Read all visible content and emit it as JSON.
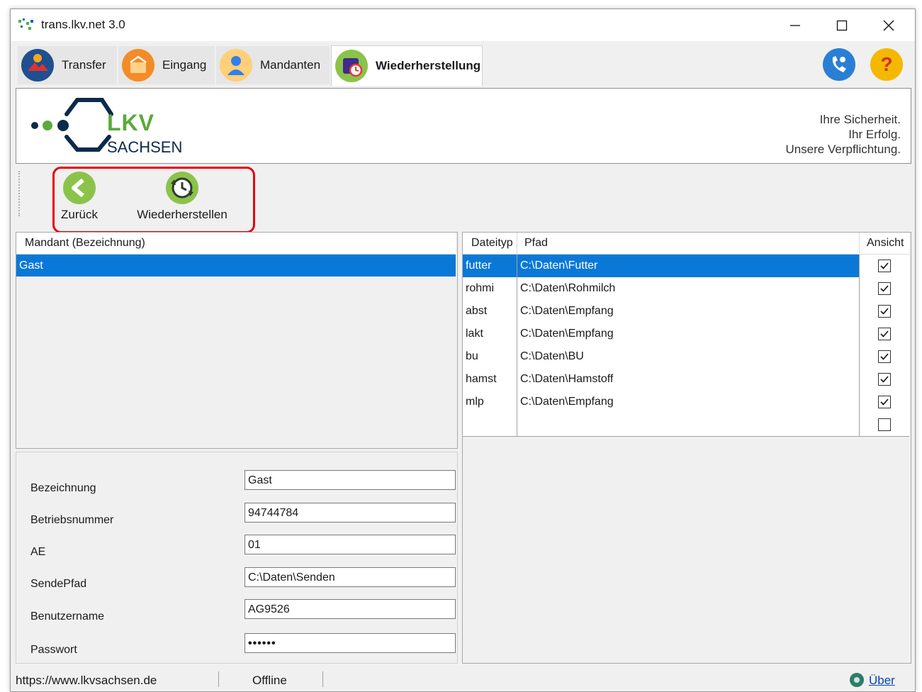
{
  "window": {
    "title": "trans.lkv.net 3.0"
  },
  "tabs": [
    {
      "label": "Transfer",
      "icon": "transfer-icon"
    },
    {
      "label": "Eingang",
      "icon": "inbox-icon"
    },
    {
      "label": "Mandanten",
      "icon": "user-icon"
    },
    {
      "label": "Wiederherstellung",
      "icon": "restore-icon",
      "active": true
    }
  ],
  "header_icons": [
    "phone-support-icon",
    "help-icon"
  ],
  "banner": {
    "logo_top": "LKV",
    "logo_bottom": "SACHSEN",
    "tagline": [
      "Ihre Sicherheit.",
      "Ihr Erfolg.",
      "Unsere Verpflichtung."
    ]
  },
  "toolbar": {
    "back_label": "Zurück",
    "restore_label": "Wiederherstellen"
  },
  "mandant_list": {
    "header": "Mandant (Bezeichnung)",
    "rows": [
      "Gast"
    ]
  },
  "form": {
    "fields": [
      {
        "label": "Bezeichnung",
        "value": "Gast"
      },
      {
        "label": "Betriebsnummer",
        "value": "94744784"
      },
      {
        "label": "AE",
        "value": "01"
      },
      {
        "label": "SendePfad",
        "value": "C:\\Daten\\Senden"
      },
      {
        "label": "Benutzername",
        "value": "AG9526"
      },
      {
        "label": "Passwort",
        "value": "••••••"
      }
    ]
  },
  "file_table": {
    "headers": [
      "Dateityp",
      "Pfad",
      "Ansicht"
    ],
    "rows": [
      {
        "type": "futter",
        "path": "C:\\Daten\\Futter",
        "checked": true
      },
      {
        "type": "rohmi",
        "path": "C:\\Daten\\Rohmilch",
        "checked": true
      },
      {
        "type": "abst",
        "path": "C:\\Daten\\Empfang",
        "checked": true
      },
      {
        "type": "lakt",
        "path": "C:\\Daten\\Empfang",
        "checked": true
      },
      {
        "type": "bu",
        "path": "C:\\Daten\\BU",
        "checked": true
      },
      {
        "type": "hamst",
        "path": "C:\\Daten\\Hamstoff",
        "checked": true
      },
      {
        "type": "mlp",
        "path": "C:\\Daten\\Empfang",
        "checked": true
      },
      {
        "type": "",
        "path": "",
        "checked": false
      }
    ]
  },
  "status": {
    "url": "https://www.lkvsachsen.de",
    "connection": "Offline",
    "about": "Über"
  },
  "colors": {
    "selection": "#0a78d7",
    "brand_green": "#5aaa3c",
    "brand_navy": "#0c2a4a",
    "highlight_red": "#e8000c"
  }
}
